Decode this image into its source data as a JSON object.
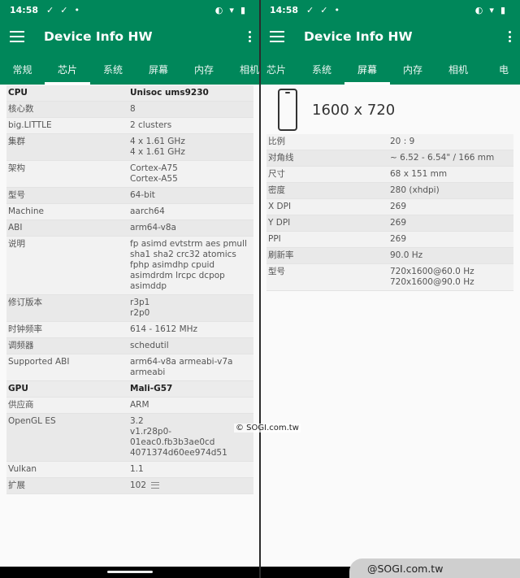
{
  "status": {
    "time": "14:58",
    "icons_left": [
      "✓",
      "✓",
      "•"
    ]
  },
  "app": {
    "title": "Device Info HW"
  },
  "left": {
    "tabs": [
      "常规",
      "芯片",
      "系统",
      "屏幕",
      "内存",
      "相机"
    ],
    "active_tab": 1,
    "rows": [
      {
        "k": "CPU",
        "v": "Unisoc ums9230",
        "section": true
      },
      {
        "k": "核心数",
        "v": "8"
      },
      {
        "k": "big.LITTLE",
        "v": "2 clusters"
      },
      {
        "k": "集群",
        "v": "4 x 1.61 GHz\n4 x 1.61 GHz"
      },
      {
        "k": "架构",
        "v": "Cortex-A75\nCortex-A55"
      },
      {
        "k": "型号",
        "v": "64-bit"
      },
      {
        "k": "Machine",
        "v": "aarch64"
      },
      {
        "k": "ABI",
        "v": "arm64-v8a"
      },
      {
        "k": "说明",
        "v": "fp asimd evtstrm aes pmull\nsha1 sha2 crc32 atomics\nfphp asimdhp cpuid\nasimdrdm lrcpc dcpop\nasimddp"
      },
      {
        "k": "修订版本",
        "v": "r3p1\nr2p0"
      },
      {
        "k": "时钟频率",
        "v": "614 - 1612 MHz"
      },
      {
        "k": "调频器",
        "v": "schedutil"
      },
      {
        "k": "Supported ABI",
        "v": "arm64-v8a armeabi-v7a\narmeabi"
      },
      {
        "k": "GPU",
        "v": "Mali-G57",
        "section": true
      },
      {
        "k": "供应商",
        "v": "ARM"
      },
      {
        "k": "OpenGL ES",
        "v": "3.2\nv1.r28p0-01eac0.fb3b3ae0cd\n4071374d60ee974d51"
      },
      {
        "k": "Vulkan",
        "v": "1.1"
      },
      {
        "k": "扩展",
        "v": "102"
      }
    ]
  },
  "right": {
    "tabs": [
      "芯片",
      "系统",
      "屏幕",
      "内存",
      "相机",
      "电"
    ],
    "active_tab": 2,
    "resolution": "1600 x 720",
    "rows": [
      {
        "k": "比例",
        "v": "20 : 9"
      },
      {
        "k": "对角线",
        "v": "~ 6.52 - 6.54\" / 166 mm"
      },
      {
        "k": "尺寸",
        "v": "68 x 151 mm"
      },
      {
        "k": "密度",
        "v": "280 (xhdpi)"
      },
      {
        "k": "X DPI",
        "v": "269"
      },
      {
        "k": "Y DPI",
        "v": "269"
      },
      {
        "k": "PPI",
        "v": "269"
      },
      {
        "k": "刷新率",
        "v": "90.0 Hz"
      },
      {
        "k": "型号",
        "v": "720x1600@60.0 Hz\n720x1600@90.0 Hz"
      }
    ]
  },
  "watermark": {
    "mid": "© SOGI.com.tw",
    "bottom": "@SOGI.com.tw"
  }
}
